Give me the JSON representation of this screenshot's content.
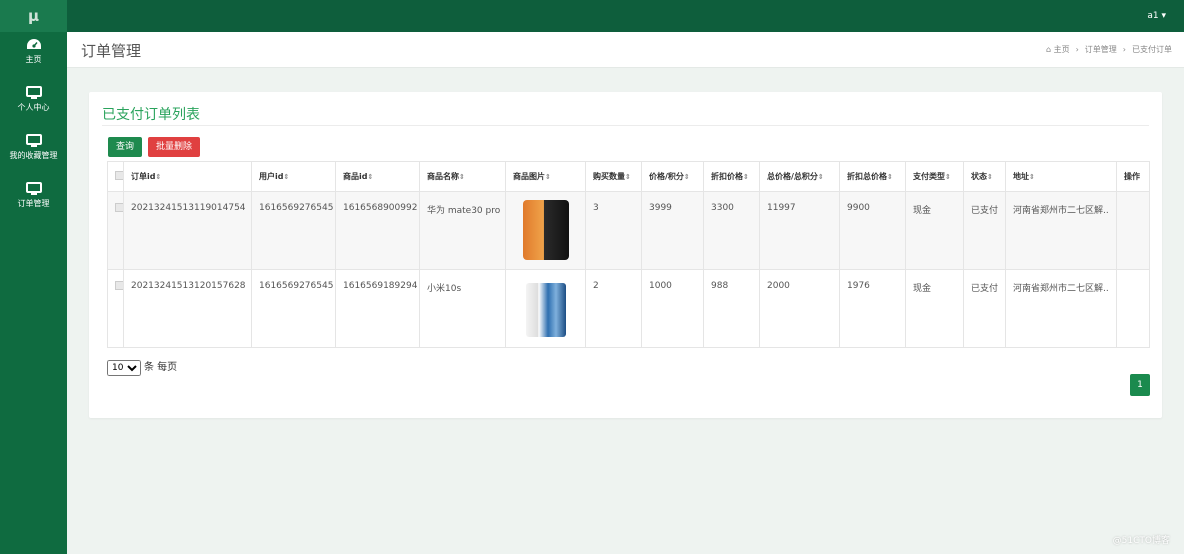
{
  "app": {
    "logo": "μ",
    "user": "a1 ▾"
  },
  "sidebar": {
    "items": [
      {
        "label": "主页",
        "icon": "dashboard-icon"
      },
      {
        "label": "个人中心",
        "icon": "monitor-icon"
      },
      {
        "label": "我的收藏管理",
        "icon": "monitor-icon"
      },
      {
        "label": "订单管理",
        "icon": "monitor-icon"
      }
    ]
  },
  "header": {
    "title": "订单管理",
    "breadcrumb": [
      "主页",
      "订单管理",
      "已支付订单"
    ]
  },
  "panel": {
    "title": "已支付订单列表",
    "query_label": "查询",
    "delete_label": "批量删除"
  },
  "table": {
    "headers": [
      "订单id",
      "用户id",
      "商品id",
      "商品名称",
      "商品图片",
      "购买数量",
      "价格/积分",
      "折扣价格",
      "总价格/总积分",
      "折扣总价格",
      "支付类型",
      "状态",
      "地址",
      "操作"
    ],
    "rows": [
      {
        "order_id": "20213241513119014754",
        "user_id": "1616569276545",
        "product_id": "1616568900992",
        "name": "华为 mate30 pro",
        "qty": "3",
        "price": "3999",
        "discount_price": "3300",
        "total": "11997",
        "discount_total": "9900",
        "pay_type": "现金",
        "status": "已支付",
        "address": "河南省郑州市二七区解.."
      },
      {
        "order_id": "20213241513120157628",
        "user_id": "1616569276545",
        "product_id": "1616569189294",
        "name": "小米10s",
        "qty": "2",
        "price": "1000",
        "discount_price": "988",
        "total": "2000",
        "discount_total": "1976",
        "pay_type": "现金",
        "status": "已支付",
        "address": "河南省郑州市二七区解.."
      }
    ]
  },
  "pagination": {
    "page_size": "10",
    "page_size_suffix": "条 每页",
    "current_page": "1"
  },
  "watermark": "@51CTO博客",
  "colors": {
    "topbar": "#0e5e3c",
    "sidebar": "#0f6b40",
    "accent": "#2aa35c",
    "danger": "#e04040"
  }
}
